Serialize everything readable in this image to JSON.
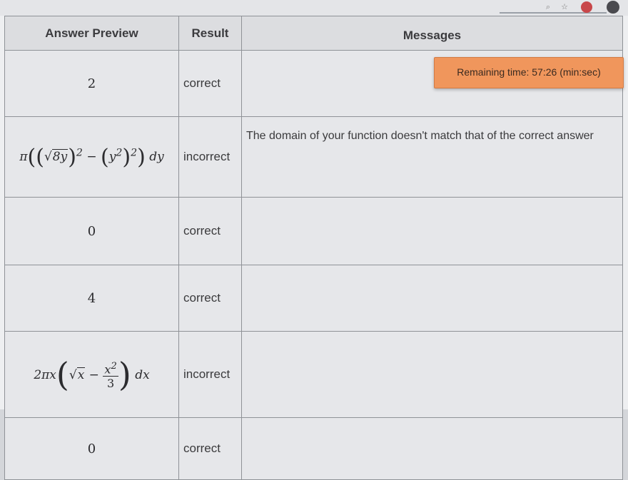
{
  "header": {
    "answer_preview": "Answer Preview",
    "result": "Result",
    "messages": "Messages"
  },
  "timer": {
    "text": "Remaining time: 57:26 (min:sec)"
  },
  "rows": [
    {
      "preview": "2",
      "result": "correct",
      "message": ""
    },
    {
      "preview": "π((√(8y))² − (y²)²) dy",
      "result": "incorrect",
      "message": "The domain of your function doesn't match that of the correct answer"
    },
    {
      "preview": "0",
      "result": "correct",
      "message": ""
    },
    {
      "preview": "4",
      "result": "correct",
      "message": ""
    },
    {
      "preview": "2πx(√x − x²/3) dx",
      "result": "incorrect",
      "message": ""
    },
    {
      "preview": "0",
      "result": "correct",
      "message": ""
    }
  ],
  "colors": {
    "timer_bg": "#f0965c",
    "grid_line": "#8f9297"
  },
  "icons": [
    "zoom-icon",
    "star-icon",
    "extension-red-icon",
    "profile-icon"
  ]
}
